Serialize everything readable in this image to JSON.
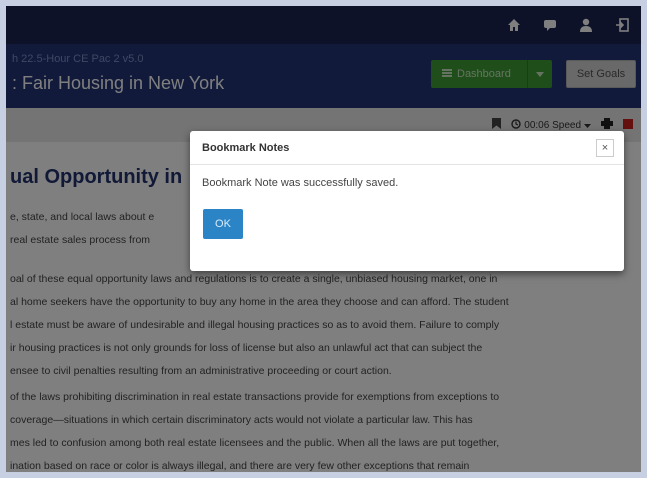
{
  "topbar": {
    "icons": [
      "home-icon",
      "message-icon",
      "user-icon",
      "logout-icon"
    ]
  },
  "header": {
    "course_subtitle": "h 22.5-Hour CE Pac 2 v5.0",
    "course_title": ": Fair Housing in New York",
    "dashboard_label": "Dashboard",
    "set_goals_label": "Set Goals"
  },
  "toolbar": {
    "speed_label": "00:06 Speed"
  },
  "content": {
    "heading": "ual Opportunity in",
    "paragraph1": [
      "e, state, and local laws about e",
      "real estate sales process from"
    ],
    "paragraph2": [
      "oal of these equal opportunity laws and regulations is to create a single, unbiased housing market, one in",
      "al home seekers have the opportunity to buy any home in the area they choose and can afford. The student",
      "l estate must be aware of undesirable and illegal housing practices so as to avoid them. Failure to comply",
      "ir housing practices is not only grounds for loss of license but also an unlawful act that can subject the",
      "ensee to civil penalties resulting from an administrative proceeding or court action."
    ],
    "paragraph3": [
      "of the laws prohibiting discrimination in real estate transactions provide for exemptions from exceptions to",
      "coverage—situations in which certain discriminatory acts would not violate a particular law. This has",
      "mes led to confusion among both real estate licensees and the public. When all the laws are put together,",
      "ination based on race or color is always illegal, and there are very few other exceptions that remain"
    ]
  },
  "modal": {
    "title": "Bookmark Notes",
    "close_symbol": "×",
    "message": "Bookmark Note was successfully saved.",
    "ok_label": "OK"
  },
  "colors": {
    "topbar": "#1b2453",
    "header": "#233477",
    "dashboard_button": "#3f9d34",
    "ok_button": "#2b84c6",
    "heading": "#22336f"
  }
}
